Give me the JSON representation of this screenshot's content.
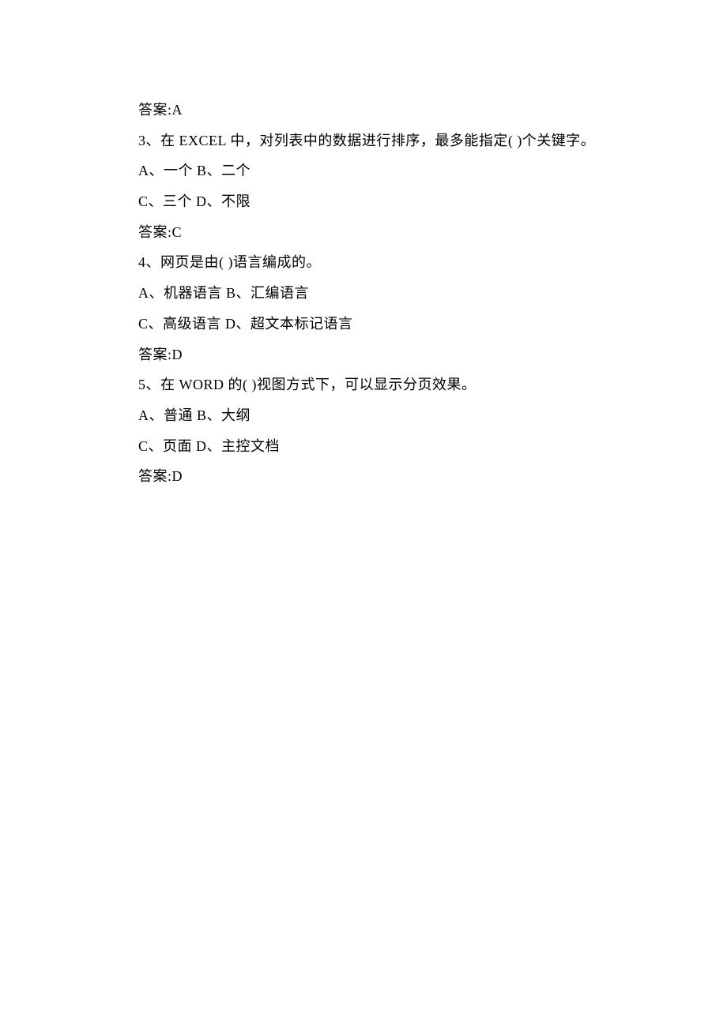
{
  "lines": {
    "l1": "答案:A",
    "l2": "3、在 EXCEL 中，对列表中的数据进行排序，最多能指定( )个关键字。",
    "l3": "A、一个 B、二个",
    "l4": "C、三个 D、不限",
    "l5": "答案:C",
    "l6": "4、网页是由( )语言编成的。",
    "l7": "A、机器语言 B、汇编语言",
    "l8": "C、高级语言 D、超文本标记语言",
    "l9": "答案:D",
    "l10": "5、在 WORD 的( )视图方式下，可以显示分页效果。",
    "l11": "A、普通 B、大纲",
    "l12": "C、页面 D、主控文档",
    "l13": "答案:D"
  }
}
